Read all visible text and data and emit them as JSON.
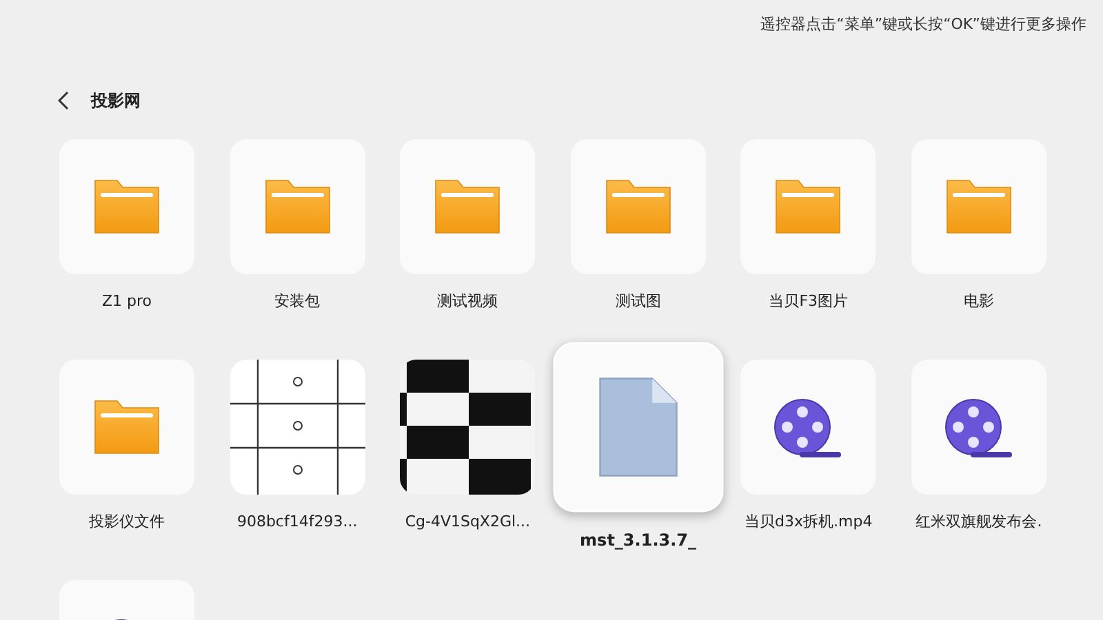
{
  "hint": "遥控器点击“菜单”键或长按“OK”键进行更多操作",
  "header": {
    "title": "投影网"
  },
  "items": [
    {
      "kind": "folder",
      "label": "Z1 pro",
      "selected": false
    },
    {
      "kind": "folder",
      "label": "安装包",
      "selected": false
    },
    {
      "kind": "folder",
      "label": "测试视频",
      "selected": false
    },
    {
      "kind": "folder",
      "label": "测试图",
      "selected": false
    },
    {
      "kind": "folder",
      "label": "当贝F3图片",
      "selected": false
    },
    {
      "kind": "folder",
      "label": "电影",
      "selected": false
    },
    {
      "kind": "folder",
      "label": "投影仪文件",
      "selected": false
    },
    {
      "kind": "picture",
      "label": "908bcf14f293...",
      "selected": false
    },
    {
      "kind": "picture",
      "label": "Cg-4V1SqX2Gl...",
      "selected": false
    },
    {
      "kind": "file",
      "label": "mst_3.1.3.7_",
      "selected": true
    },
    {
      "kind": "video",
      "label": "当贝d3x拆机.mp4",
      "selected": false
    },
    {
      "kind": "video",
      "label": "红米双旗舰发布会.",
      "selected": false
    },
    {
      "kind": "video",
      "selected": false
    }
  ]
}
